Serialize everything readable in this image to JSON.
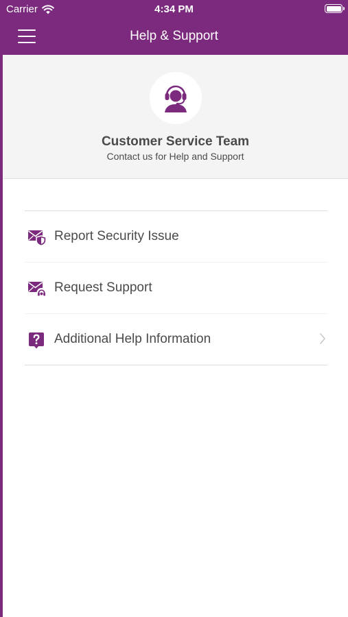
{
  "status_bar": {
    "carrier": "Carrier",
    "time": "4:34 PM",
    "battery_level": 1.0
  },
  "nav": {
    "title": "Help & Support",
    "menu_icon": "hamburger-menu-icon"
  },
  "header": {
    "avatar_icon": "headset-agent-icon",
    "title": "Customer Service Team",
    "subtitle": "Contact us for Help and Support"
  },
  "menu": {
    "items": [
      {
        "label": "Report Security Issue",
        "icon": "mail-shield-icon",
        "has_chevron": false
      },
      {
        "label": "Request Support",
        "icon": "mail-headset-icon",
        "has_chevron": false
      },
      {
        "label": "Additional Help Information",
        "icon": "question-bubble-icon",
        "has_chevron": true
      }
    ]
  },
  "colors": {
    "brand": "#7b2a7e",
    "text": "#4a4a4a",
    "header_bg": "#f4f4f4",
    "chevron": "#c7c7cc"
  }
}
